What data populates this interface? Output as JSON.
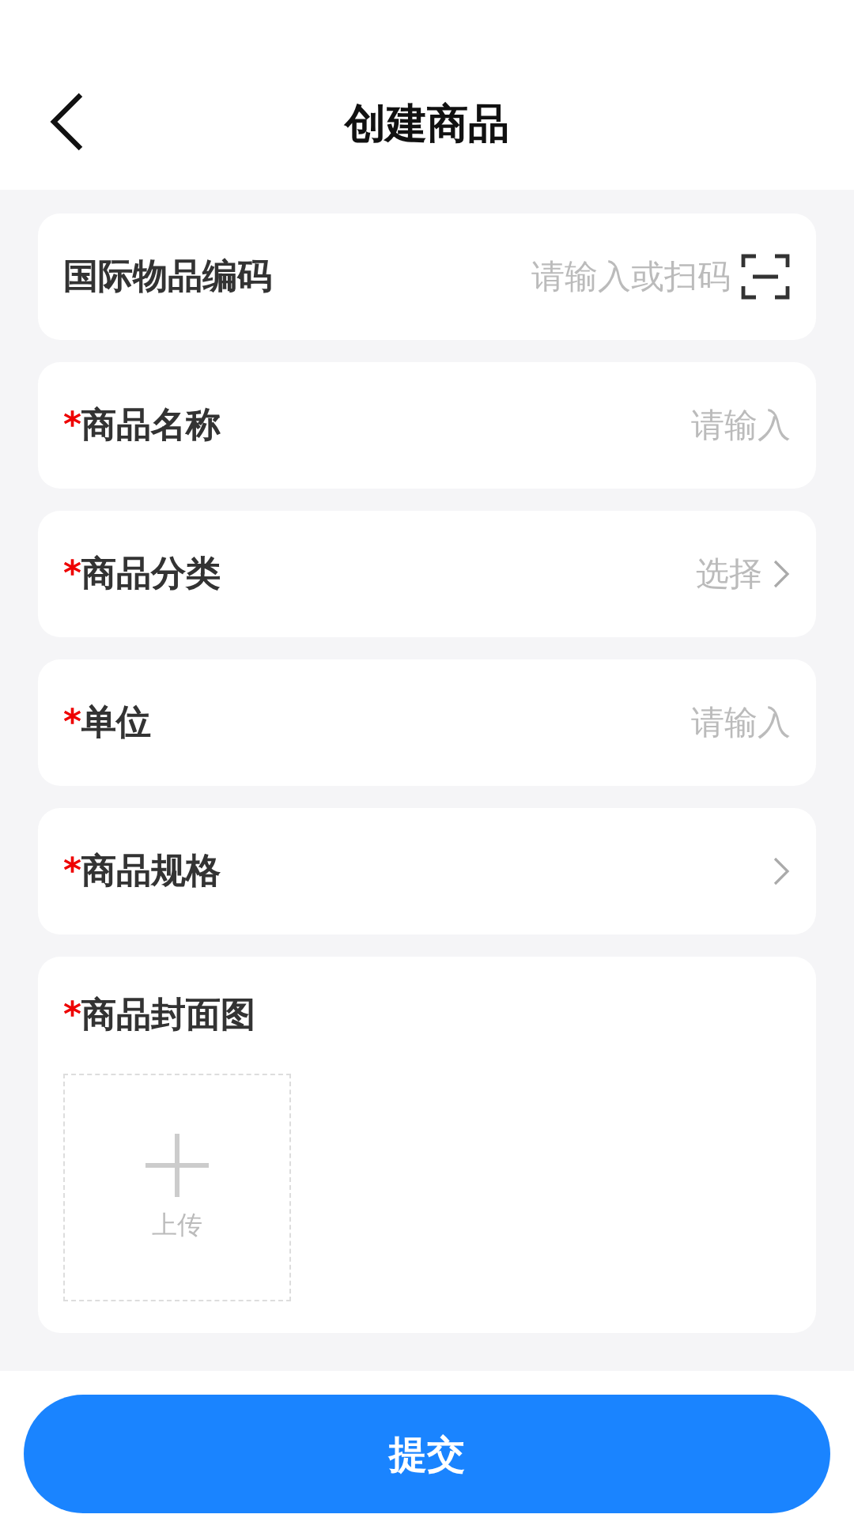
{
  "header": {
    "title": "创建商品"
  },
  "fields": [
    {
      "kind": "scan",
      "label": "国际物品编码",
      "placeholder": "请输入或扫码"
    },
    {
      "kind": "input",
      "required_mark": "*",
      "label": "商品名称",
      "placeholder": "请输入"
    },
    {
      "kind": "select",
      "required_mark": "*",
      "label": "商品分类",
      "placeholder": "选择"
    },
    {
      "kind": "input",
      "required_mark": "*",
      "label": "单位",
      "placeholder": "请输入"
    },
    {
      "kind": "link",
      "required_mark": "*",
      "label": "商品规格"
    }
  ],
  "cover": {
    "required_mark": "*",
    "label": "商品封面图",
    "upload_label": "上传"
  },
  "submit": {
    "label": "提交"
  }
}
